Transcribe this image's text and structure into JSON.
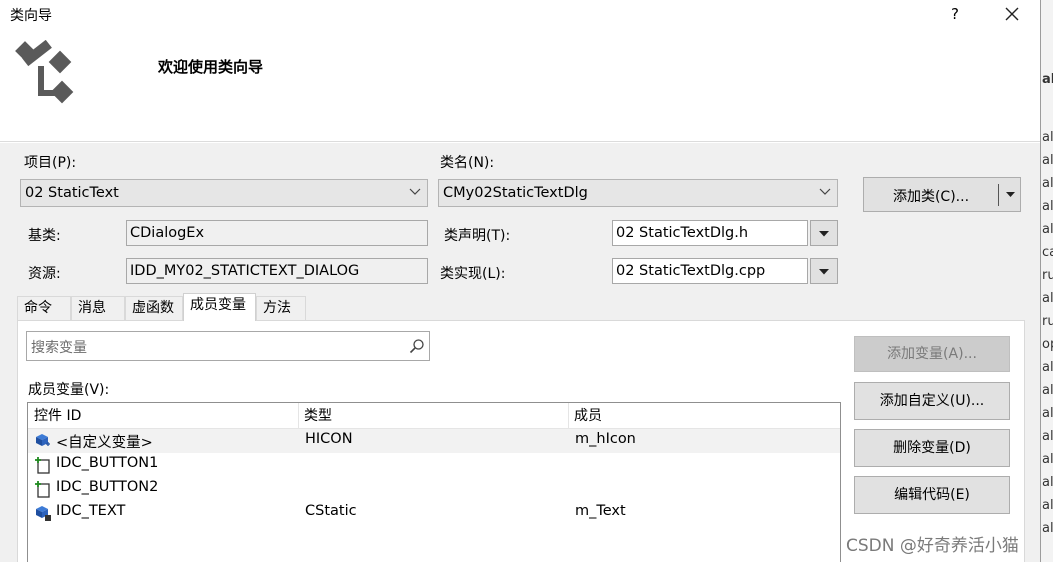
{
  "window": {
    "title": "类向导",
    "help_label": "?"
  },
  "header": {
    "title": "欢迎使用类向导"
  },
  "project": {
    "label": "项目(P):",
    "value": "02 StaticText"
  },
  "classname": {
    "label": "类名(N):",
    "value": "CMy02StaticTextDlg"
  },
  "add_class_label": "添加类(C)...",
  "base_class": {
    "label": "基类:",
    "value": "CDialogEx"
  },
  "resource": {
    "label": "资源:",
    "value": "IDD_MY02_STATICTEXT_DIALOG"
  },
  "class_decl": {
    "label": "类声明(T):",
    "value": "02 StaticTextDlg.h"
  },
  "class_impl": {
    "label": "类实现(L):",
    "value": "02 StaticTextDlg.cpp"
  },
  "tabs": [
    {
      "label": "命令"
    },
    {
      "label": "消息"
    },
    {
      "label": "虚函数"
    },
    {
      "label": "成员变量"
    },
    {
      "label": "方法"
    }
  ],
  "search": {
    "placeholder": "搜索变量"
  },
  "members": {
    "label": "成员变量(V):",
    "columns": [
      "控件 ID",
      "类型",
      "成员"
    ],
    "rows": [
      {
        "id": "<自定义变量>",
        "type": "HICON",
        "member": "m_hIcon",
        "icon": "custom-variable-icon"
      },
      {
        "id": "IDC_BUTTON1",
        "type": "",
        "member": "",
        "icon": "control-add-icon"
      },
      {
        "id": "IDC_BUTTON2",
        "type": "",
        "member": "",
        "icon": "control-add-icon"
      },
      {
        "id": "IDC_TEXT",
        "type": "CStatic",
        "member": "m_Text",
        "icon": "control-variable-icon"
      }
    ]
  },
  "buttons": {
    "add_variable": "添加变量(A)...",
    "add_custom": "添加自定义(U)...",
    "delete_variable": "删除变量(D)",
    "edit_code": "编辑代码(E)"
  },
  "watermark": "CSDN @好奇养活小猫",
  "background_window_fragments": [
    "al",
    "als",
    "als",
    "als",
    "als",
    "als",
    "als",
    "ca",
    "ru",
    "als",
    "ru",
    "op",
    "als",
    "als",
    "als",
    "als",
    "als",
    "als",
    "als"
  ]
}
